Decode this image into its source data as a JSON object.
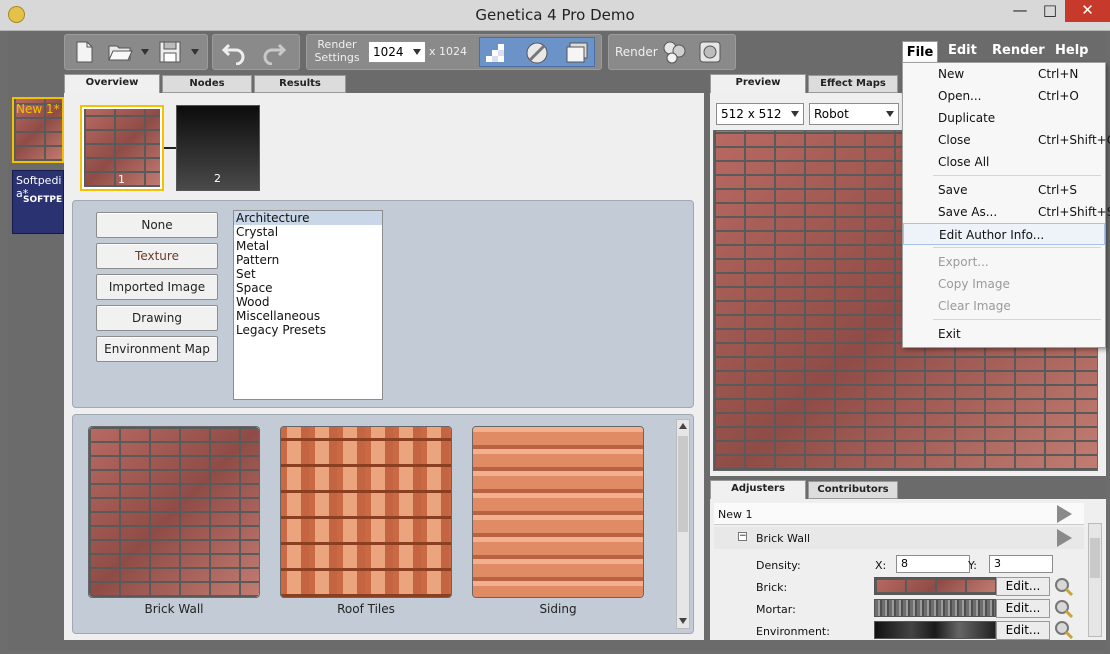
{
  "window": {
    "title": "Genetica 4 Pro Demo",
    "min": "—",
    "max": "□",
    "close": "✕"
  },
  "toolbar": {
    "render_settings_label": "Render\nSettings",
    "resolution_value": "1024",
    "resolution_suffix": "x 1024",
    "render_label": "Render"
  },
  "menubar": {
    "items": [
      "File",
      "Edit",
      "Render",
      "Help"
    ]
  },
  "file_menu": [
    {
      "label": "New",
      "shortcut": "Ctrl+N",
      "enabled": true
    },
    {
      "label": "Open...",
      "shortcut": "Ctrl+O",
      "enabled": true
    },
    {
      "label": "Duplicate",
      "shortcut": "",
      "enabled": true
    },
    {
      "label": "Close",
      "shortcut": "Ctrl+Shift+C",
      "enabled": true
    },
    {
      "label": "Close All",
      "shortcut": "",
      "enabled": true
    },
    {
      "label": "Save",
      "shortcut": "Ctrl+S",
      "enabled": true
    },
    {
      "label": "Save As...",
      "shortcut": "Ctrl+Shift+S",
      "enabled": true
    },
    {
      "label": "Edit Author Info...",
      "shortcut": "",
      "enabled": true,
      "highlighted": true
    },
    {
      "label": "Export...",
      "shortcut": "",
      "enabled": false
    },
    {
      "label": "Copy Image",
      "shortcut": "",
      "enabled": false
    },
    {
      "label": "Clear Image",
      "shortcut": "",
      "enabled": false
    },
    {
      "label": "Exit",
      "shortcut": "",
      "enabled": true
    }
  ],
  "docs": [
    {
      "label": "New 1*"
    },
    {
      "label": "Softpedi a*",
      "sub": "SOFTPE"
    }
  ],
  "left_tabs": [
    "Overview",
    "Nodes",
    "Results"
  ],
  "nodes": [
    {
      "label": "1"
    },
    {
      "label": "2"
    }
  ],
  "type_buttons": [
    "None",
    "Texture",
    "Imported Image",
    "Drawing",
    "Environment Map"
  ],
  "categories": [
    "Architecture",
    "Crystal",
    "Metal",
    "Pattern",
    "Set",
    "Space",
    "Wood",
    "Miscellaneous",
    "Legacy Presets"
  ],
  "presets": [
    {
      "label": "Brick Wall",
      "icon": "brick-texture"
    },
    {
      "label": "Roof Tiles",
      "icon": "roof-tiles-texture"
    },
    {
      "label": "Siding",
      "icon": "siding-texture"
    }
  ],
  "right_tabs": [
    "Preview",
    "Effect Maps"
  ],
  "preview": {
    "size": "512 x 512",
    "model": "Robot"
  },
  "adj_tabs": [
    "Adjusters",
    "Contributors"
  ],
  "adjusters": {
    "root": "New 1",
    "group": "Brick Wall",
    "density_label": "Density:",
    "x_label": "X:",
    "x_value": "8",
    "y_label": "Y:",
    "y_value": "3",
    "brick_label": "Brick:",
    "mortar_label": "Mortar:",
    "environment_label": "Environment:",
    "edit_label": "Edit..."
  },
  "colors": {
    "accent_yellow": "#f2c200",
    "selection": "#c9d6e8",
    "close_red": "#c73a2b"
  }
}
